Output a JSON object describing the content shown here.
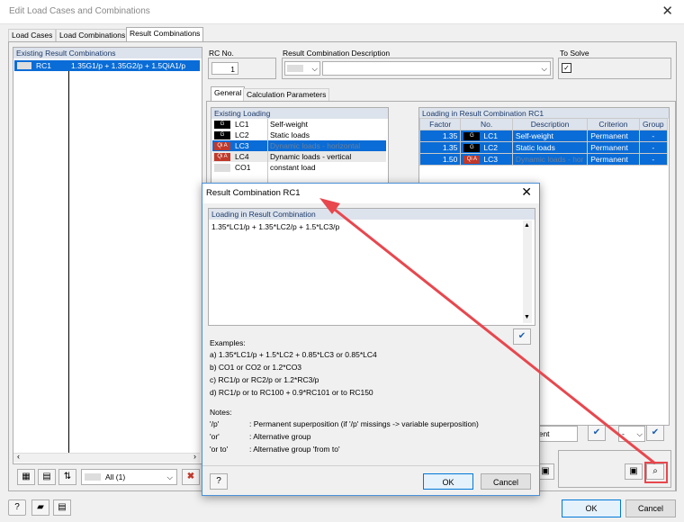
{
  "window": {
    "title": "Edit Load Cases and Combinations",
    "close_icon": "close-icon"
  },
  "tabs": [
    "Load Cases",
    "Load Combinations",
    "Result Combinations"
  ],
  "left": {
    "header": "Existing Result Combinations",
    "item_id": "RC1",
    "item_formula": "1.35G1/p + 1.35G2/p + 1.5QiA1/p",
    "filter_value": "All (1)"
  },
  "rc": {
    "no_label": "RC No.",
    "no_value": "1",
    "desc_label": "Result Combination Description",
    "solve_label": "To Solve"
  },
  "subtabs": [
    "General",
    "Calculation Parameters"
  ],
  "existing_loading": {
    "header": "Existing Loading",
    "rows": [
      {
        "badge": "G",
        "id": "LC1",
        "desc": "Self-weight"
      },
      {
        "badge": "G",
        "id": "LC2",
        "desc": "Static loads"
      },
      {
        "badge": "Qi A",
        "id": "LC3",
        "desc": "Dynamic loads - horizontal"
      },
      {
        "badge": "Qi A",
        "id": "LC4",
        "desc": "Dynamic loads - vertical"
      },
      {
        "badge": "",
        "id": "CO1",
        "desc": "constant load"
      }
    ]
  },
  "loading_rc": {
    "header": "Loading in Result Combination RC1",
    "columns": [
      "Factor",
      "No.",
      "Description",
      "Criterion",
      "Group"
    ],
    "rows": [
      {
        "factor": "1.35",
        "badge": "G",
        "no": "LC1",
        "desc": "Self-weight",
        "criterion": "Permanent",
        "group": "-"
      },
      {
        "factor": "1.35",
        "badge": "G",
        "no": "LC2",
        "desc": "Static loads",
        "criterion": "Permanent",
        "group": "-"
      },
      {
        "factor": "1.50",
        "badge": "Qi A",
        "no": "LC3",
        "desc": "Dynamic loads - hor",
        "criterion": "Permanent",
        "group": "-"
      }
    ],
    "criterion_value": "nent",
    "group_value": "-"
  },
  "dialog": {
    "title": "Result Combination RC1",
    "section_label": "Loading in Result Combination",
    "formula": "1.35*LC1/p + 1.35*LC2/p + 1.5*LC3/p",
    "examples_title": "Examples:",
    "examples": [
      "a)  1.35*LC1/p + 1.5*LC2 + 0.85*LC3 or 0.85*LC4",
      "b)  CO1 or CO2 or 1.2*CO3",
      "c)  RC1/p or RC2/p or 1.2*RC3/p",
      "d)  RC1/p or to RC100 + 0.9*RC101 or to RC150"
    ],
    "notes_title": "Notes:",
    "notes": [
      {
        "key": "'/p'",
        "text": ": Permanent superposition (if '/p' missings -> variable superposition)"
      },
      {
        "key": "'or'",
        "text": ": Alternative group"
      },
      {
        "key": "'or to'",
        "text": ": Alternative group 'from to'"
      }
    ],
    "ok_label": "OK",
    "cancel_label": "Cancel"
  },
  "footer": {
    "ok_label": "OK",
    "cancel_label": "Cancel"
  },
  "colors": {
    "accent": "#0a6cd6",
    "arrow": "#e8474e"
  }
}
